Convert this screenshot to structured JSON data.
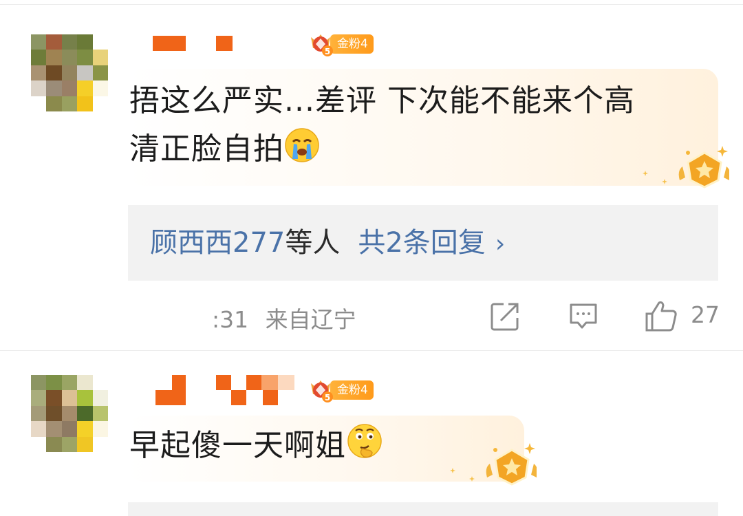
{
  "comments": [
    {
      "fan_badge": "金粉4",
      "text_line1": "捂这么严实...差评 下次能不能来个高",
      "text_line2": "清正脸自拍",
      "text_emoji": "crying-face-emoji",
      "replies": {
        "users": "顾西西277",
        "users_suffix": "等人",
        "count_label": "共2条回复",
        "chevron": "›"
      },
      "time_fragment": ":31",
      "location": "来自辽宁",
      "like_count": "27"
    },
    {
      "fan_badge": "金粉4",
      "text": "早起傻一天啊姐",
      "text_emoji": "thinking-face-emoji"
    }
  ],
  "colors": {
    "link_blue": "#4a72a8",
    "badge_orange": "#ff9a1a",
    "meta_gray": "#8c8c8c",
    "reply_bg": "#f2f2f2"
  },
  "icons": [
    "share-icon",
    "comment-icon",
    "like-icon",
    "fan-crown-icon",
    "gold-rank-badge-icon"
  ]
}
